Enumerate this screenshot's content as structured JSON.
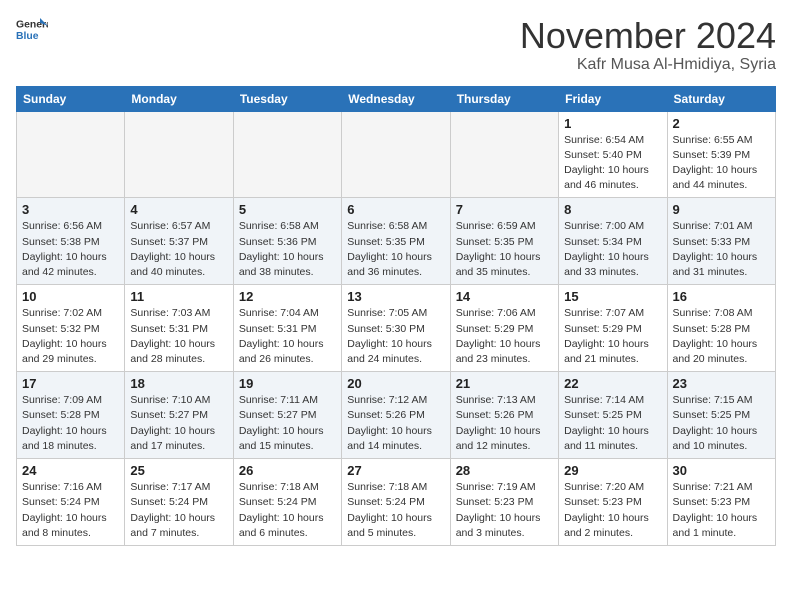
{
  "header": {
    "logo_line1": "General",
    "logo_line2": "Blue",
    "month": "November 2024",
    "location": "Kafr Musa Al-Hmidiya, Syria"
  },
  "days_of_week": [
    "Sunday",
    "Monday",
    "Tuesday",
    "Wednesday",
    "Thursday",
    "Friday",
    "Saturday"
  ],
  "weeks": [
    [
      {
        "day": "",
        "info": ""
      },
      {
        "day": "",
        "info": ""
      },
      {
        "day": "",
        "info": ""
      },
      {
        "day": "",
        "info": ""
      },
      {
        "day": "",
        "info": ""
      },
      {
        "day": "1",
        "info": "Sunrise: 6:54 AM\nSunset: 5:40 PM\nDaylight: 10 hours and 46 minutes."
      },
      {
        "day": "2",
        "info": "Sunrise: 6:55 AM\nSunset: 5:39 PM\nDaylight: 10 hours and 44 minutes."
      }
    ],
    [
      {
        "day": "3",
        "info": "Sunrise: 6:56 AM\nSunset: 5:38 PM\nDaylight: 10 hours and 42 minutes."
      },
      {
        "day": "4",
        "info": "Sunrise: 6:57 AM\nSunset: 5:37 PM\nDaylight: 10 hours and 40 minutes."
      },
      {
        "day": "5",
        "info": "Sunrise: 6:58 AM\nSunset: 5:36 PM\nDaylight: 10 hours and 38 minutes."
      },
      {
        "day": "6",
        "info": "Sunrise: 6:58 AM\nSunset: 5:35 PM\nDaylight: 10 hours and 36 minutes."
      },
      {
        "day": "7",
        "info": "Sunrise: 6:59 AM\nSunset: 5:35 PM\nDaylight: 10 hours and 35 minutes."
      },
      {
        "day": "8",
        "info": "Sunrise: 7:00 AM\nSunset: 5:34 PM\nDaylight: 10 hours and 33 minutes."
      },
      {
        "day": "9",
        "info": "Sunrise: 7:01 AM\nSunset: 5:33 PM\nDaylight: 10 hours and 31 minutes."
      }
    ],
    [
      {
        "day": "10",
        "info": "Sunrise: 7:02 AM\nSunset: 5:32 PM\nDaylight: 10 hours and 29 minutes."
      },
      {
        "day": "11",
        "info": "Sunrise: 7:03 AM\nSunset: 5:31 PM\nDaylight: 10 hours and 28 minutes."
      },
      {
        "day": "12",
        "info": "Sunrise: 7:04 AM\nSunset: 5:31 PM\nDaylight: 10 hours and 26 minutes."
      },
      {
        "day": "13",
        "info": "Sunrise: 7:05 AM\nSunset: 5:30 PM\nDaylight: 10 hours and 24 minutes."
      },
      {
        "day": "14",
        "info": "Sunrise: 7:06 AM\nSunset: 5:29 PM\nDaylight: 10 hours and 23 minutes."
      },
      {
        "day": "15",
        "info": "Sunrise: 7:07 AM\nSunset: 5:29 PM\nDaylight: 10 hours and 21 minutes."
      },
      {
        "day": "16",
        "info": "Sunrise: 7:08 AM\nSunset: 5:28 PM\nDaylight: 10 hours and 20 minutes."
      }
    ],
    [
      {
        "day": "17",
        "info": "Sunrise: 7:09 AM\nSunset: 5:28 PM\nDaylight: 10 hours and 18 minutes."
      },
      {
        "day": "18",
        "info": "Sunrise: 7:10 AM\nSunset: 5:27 PM\nDaylight: 10 hours and 17 minutes."
      },
      {
        "day": "19",
        "info": "Sunrise: 7:11 AM\nSunset: 5:27 PM\nDaylight: 10 hours and 15 minutes."
      },
      {
        "day": "20",
        "info": "Sunrise: 7:12 AM\nSunset: 5:26 PM\nDaylight: 10 hours and 14 minutes."
      },
      {
        "day": "21",
        "info": "Sunrise: 7:13 AM\nSunset: 5:26 PM\nDaylight: 10 hours and 12 minutes."
      },
      {
        "day": "22",
        "info": "Sunrise: 7:14 AM\nSunset: 5:25 PM\nDaylight: 10 hours and 11 minutes."
      },
      {
        "day": "23",
        "info": "Sunrise: 7:15 AM\nSunset: 5:25 PM\nDaylight: 10 hours and 10 minutes."
      }
    ],
    [
      {
        "day": "24",
        "info": "Sunrise: 7:16 AM\nSunset: 5:24 PM\nDaylight: 10 hours and 8 minutes."
      },
      {
        "day": "25",
        "info": "Sunrise: 7:17 AM\nSunset: 5:24 PM\nDaylight: 10 hours and 7 minutes."
      },
      {
        "day": "26",
        "info": "Sunrise: 7:18 AM\nSunset: 5:24 PM\nDaylight: 10 hours and 6 minutes."
      },
      {
        "day": "27",
        "info": "Sunrise: 7:18 AM\nSunset: 5:24 PM\nDaylight: 10 hours and 5 minutes."
      },
      {
        "day": "28",
        "info": "Sunrise: 7:19 AM\nSunset: 5:23 PM\nDaylight: 10 hours and 3 minutes."
      },
      {
        "day": "29",
        "info": "Sunrise: 7:20 AM\nSunset: 5:23 PM\nDaylight: 10 hours and 2 minutes."
      },
      {
        "day": "30",
        "info": "Sunrise: 7:21 AM\nSunset: 5:23 PM\nDaylight: 10 hours and 1 minute."
      }
    ]
  ]
}
